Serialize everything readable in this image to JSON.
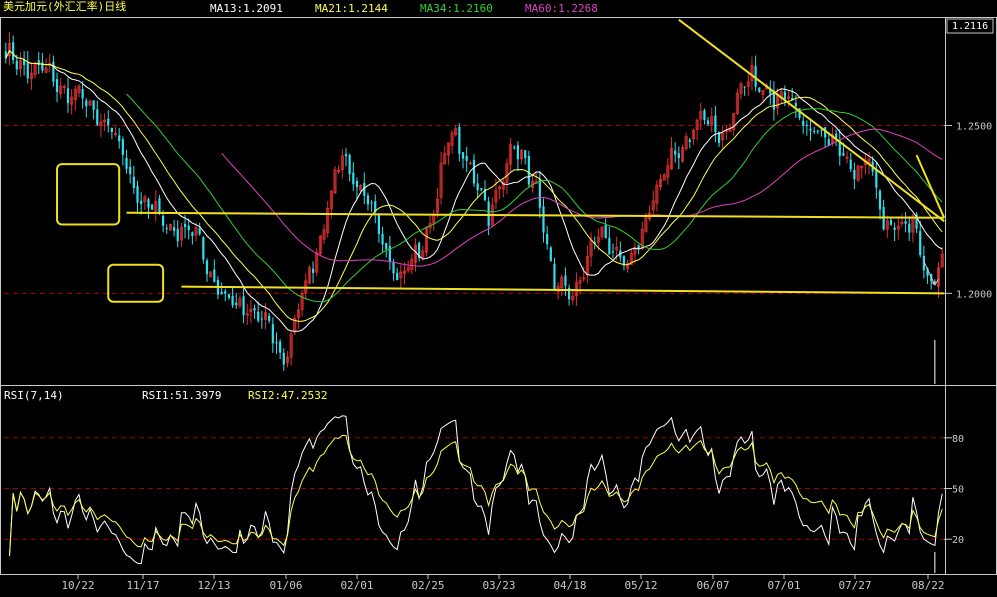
{
  "header": {
    "title": "美元加元(外汇汇率)日线",
    "ma13": "MA13:1.2091",
    "ma21": "MA21:1.2144",
    "ma34": "MA34:1.2160",
    "ma60": "MA60:1.2268",
    "current_price": "1.2116"
  },
  "rsi_header": {
    "title": "RSI(7,14)",
    "rsi1": "RSI1:51.3979",
    "rsi2": "RSI2:47.2532"
  },
  "colors": {
    "background": "#000000",
    "up": "#e03030",
    "down": "#30e0f0",
    "ma13": "#ffffff",
    "ma21": "#ffff50",
    "ma34": "#30d030",
    "ma60": "#e040c0",
    "trendline": "#f0e020",
    "grid": "#a00000",
    "axis_text": "#c8c8c8"
  },
  "chart_data": [
    {
      "type": "candlestick",
      "title": "美元加元(外汇汇率)日线",
      "x_tick_labels": [
        "10/22",
        "11/17",
        "12/13",
        "01/06",
        "02/01",
        "02/25",
        "03/23",
        "04/18",
        "05/12",
        "06/07",
        "07/01",
        "07/27",
        "08/22"
      ],
      "y_tick_labels": [
        "1.2500",
        "1.2000"
      ],
      "ylim": [
        1.173,
        1.282
      ],
      "grid": "dashed horizontal at 1.2500 and 1.2000",
      "current_value": 1.2116,
      "price_anchors_x": [
        0,
        10,
        20,
        28,
        33,
        38,
        44,
        52,
        60,
        66,
        72,
        76,
        80,
        86,
        92,
        100,
        108,
        113,
        117,
        122,
        127,
        132,
        138,
        145,
        150,
        156,
        163,
        170,
        176,
        182,
        190,
        197,
        204,
        210,
        214,
        219,
        226,
        232,
        236,
        240,
        244,
        248,
        252,
        256
      ],
      "price_anchors_y": [
        1.27,
        1.266,
        1.258,
        1.25,
        1.238,
        1.226,
        1.221,
        1.217,
        1.197,
        1.196,
        1.189,
        1.181,
        1.194,
        1.218,
        1.241,
        1.224,
        1.204,
        1.212,
        1.226,
        1.248,
        1.238,
        1.222,
        1.244,
        1.232,
        1.201,
        1.202,
        1.219,
        1.206,
        1.226,
        1.24,
        1.252,
        1.248,
        1.266,
        1.256,
        1.262,
        1.248,
        1.247,
        1.234,
        1.243,
        1.219,
        1.221,
        1.222,
        1.203,
        1.21
      ],
      "series": [
        {
          "name": "MA13",
          "value": 1.2091
        },
        {
          "name": "MA21",
          "value": 1.2144
        },
        {
          "name": "MA34",
          "value": 1.216
        },
        {
          "name": "MA60",
          "value": 1.2268
        }
      ],
      "trendlines": [
        {
          "from": [
            184,
            1.2815
          ],
          "to": [
            256,
            1.2215
          ]
        },
        {
          "from": [
            249,
            1.2412
          ],
          "to": [
            256,
            1.2225
          ]
        },
        {
          "from": [
            33,
            1.224
          ],
          "to": [
            256,
            1.2225
          ]
        },
        {
          "from": [
            48,
            1.202
          ],
          "to": [
            256,
            1.2
          ]
        }
      ],
      "boxes": [
        {
          "x0": 14,
          "x1": 31,
          "y0": 1.2205,
          "y1": 1.2385
        },
        {
          "x0": 28,
          "x1": 43,
          "y0": 1.1975,
          "y1": 1.2085
        }
      ]
    },
    {
      "type": "line",
      "title": "RSI(7,14)",
      "y_tick_labels": [
        "80",
        "50",
        "20"
      ],
      "ylim": [
        0,
        100
      ],
      "grid": "dashed horizontal at 80, 50 and 20",
      "series": [
        {
          "name": "RSI1",
          "value": 51.3979
        },
        {
          "name": "RSI2",
          "value": 47.2532
        }
      ]
    }
  ]
}
